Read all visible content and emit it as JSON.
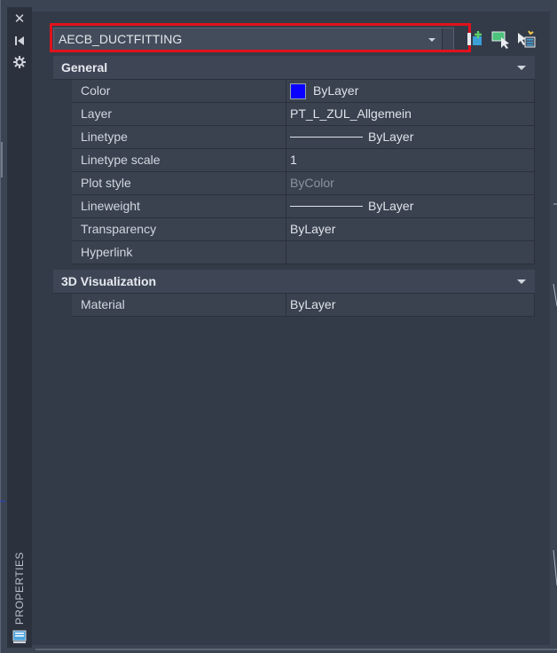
{
  "left_strip": {
    "close_icon": "close-icon",
    "autohide_icon": "autohide-icon",
    "settings_icon": "settings-icon",
    "title": "PROPERTIES",
    "bottom_icon": "properties-panel-icon"
  },
  "selector": {
    "value": "AECB_DUCTFITTING"
  },
  "toolbar": {
    "icons": [
      "toggle-pickadd-icon",
      "select-objects-icon",
      "quick-select-icon"
    ]
  },
  "colors": {
    "highlight": "#e0121c",
    "color_swatch": "#0a00ff"
  },
  "categories": [
    {
      "title": "General",
      "rows": [
        {
          "name": "Color",
          "value": "ByLayer"
        },
        {
          "name": "Layer",
          "value": "PT_L_ZUL_Allgemein"
        },
        {
          "name": "Linetype",
          "value": "ByLayer"
        },
        {
          "name": "Linetype scale",
          "value": "1"
        },
        {
          "name": "Plot style",
          "value": "ByColor"
        },
        {
          "name": "Lineweight",
          "value": "ByLayer"
        },
        {
          "name": "Transparency",
          "value": "ByLayer"
        },
        {
          "name": "Hyperlink",
          "value": ""
        }
      ]
    },
    {
      "title": "3D Visualization",
      "rows": [
        {
          "name": "Material",
          "value": "ByLayer"
        }
      ]
    }
  ]
}
